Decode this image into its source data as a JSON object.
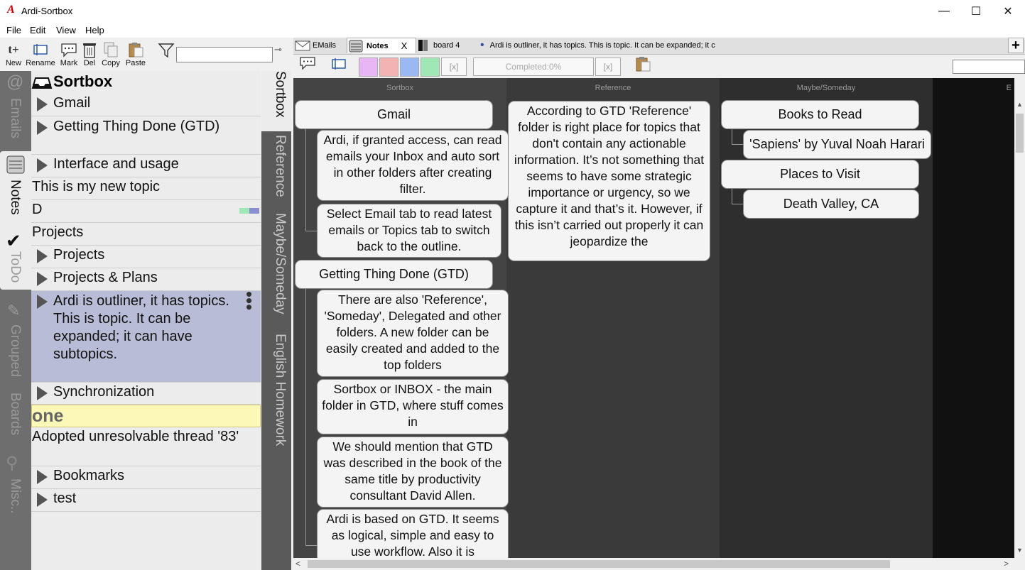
{
  "window": {
    "app_name": "Ardi-Sortbox",
    "logo": "A"
  },
  "menu": [
    "File",
    "Edit",
    "View",
    "Help"
  ],
  "toolbar": {
    "new": "New",
    "rename": "Rename",
    "mark": "Mark",
    "del": "Del",
    "copy": "Copy",
    "paste": "Paste",
    "filter_value": ""
  },
  "left_tabs": [
    "Emails",
    "Notes",
    "ToDo",
    "Grouped",
    "Boards",
    "Misc.."
  ],
  "outline": {
    "title": "Sortbox",
    "items": [
      {
        "label": "Gmail",
        "expandable": true
      },
      {
        "label": "Getting Thing Done (GTD)",
        "expandable": true
      },
      {
        "label": "Interface and usage",
        "expandable": true
      },
      {
        "label": "This is my new topic",
        "expandable": false
      },
      {
        "label": "D",
        "expandable": false
      },
      {
        "label": "Projects",
        "expandable": false
      },
      {
        "label": "Projects",
        "expandable": true
      },
      {
        "label": "Projects & Plans",
        "expandable": true
      },
      {
        "label": "Ardi is outliner, it has topics. This is topic. It can be expanded; it can have subtopics.",
        "expandable": true,
        "selected": true
      },
      {
        "label": "Synchronization",
        "expandable": true
      },
      {
        "label": "one",
        "expandable": false,
        "highlight": true
      },
      {
        "label": "Adopted unresolvable thread '83'",
        "expandable": false
      },
      {
        "label": "Bookmarks",
        "expandable": true
      },
      {
        "label": "test",
        "expandable": true
      }
    ]
  },
  "folder_tabs": [
    "Sortbox",
    "Reference",
    "Maybe/Someday",
    "English Homework"
  ],
  "board_tabs": [
    {
      "label": "EMails"
    },
    {
      "label": "Notes",
      "close": "X",
      "active": true
    },
    {
      "label": "board 4"
    },
    {
      "label": "Ardi is outliner, it has topics. This is topic. It can be expanded; it c"
    }
  ],
  "board_toolbar": {
    "color_boxes": [
      "#e8b6f5",
      "#f4b3b3",
      "#9ab8f2",
      "#9fe8b5"
    ],
    "x_label": "[x]",
    "completed": "Completed:0%",
    "x_label2": "[x]"
  },
  "colors": {
    "board_bg": "#3c3c3c",
    "dark_col": "#2a2a2a",
    "selected_row": "#b9bcd6",
    "highlight_row": "#fbf8b8"
  },
  "columns": [
    {
      "name": "Sortbox",
      "cards": [
        {
          "title": "Gmail",
          "children": [
            "Ardi, if granted access, can read emails your Inbox and auto sort in other folders after creating filter.",
            "Select Email tab to read latest emails or Topics tab to switch back to the outline."
          ]
        },
        {
          "title": "Getting Thing Done (GTD)",
          "children": [
            "There are also 'Reference', 'Someday', Delegated and other folders. A new folder can be easily created and added to the top folders",
            "Sortbox or INBOX - the main folder in GTD, where stuff comes in",
            "We should mention that GTD was described in the book of the same title by productivity consultant David Allen.",
            "Ardi is based on GTD. It seems as logical, simple and easy to use workflow. Also it is"
          ]
        }
      ]
    },
    {
      "name": "Reference",
      "cards": [
        {
          "text": "According to GTD 'Reference' folder is right place for topics that don't contain any actionable information. It’s not something that seems to have some strategic importance or urgency, so we capture it and that’s it. However, if this isn’t carried out properly it can jeopardize the"
        }
      ]
    },
    {
      "name": "Maybe/Someday",
      "cards": [
        {
          "title": "Books to Read",
          "children": [
            "'Sapiens' by Yuval Noah Harari"
          ]
        },
        {
          "title": "Places to Visit",
          "children": [
            "Death Valley, CA"
          ]
        }
      ]
    },
    {
      "name": "E"
    }
  ]
}
